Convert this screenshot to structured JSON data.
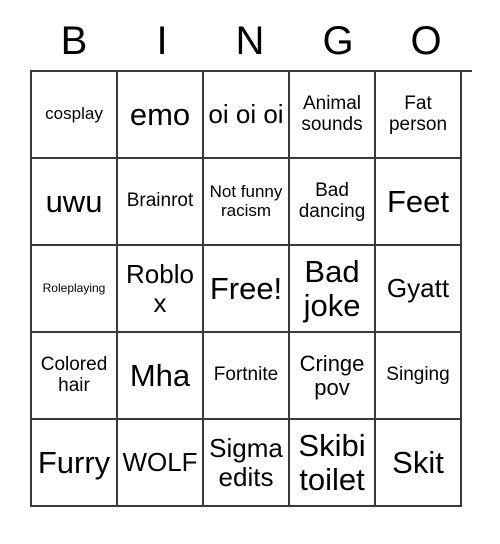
{
  "card": {
    "header_letters": [
      "B",
      "I",
      "N",
      "G",
      "O"
    ],
    "columns": 5,
    "rows": 5,
    "free_space_label": "Free!",
    "border_color": "#3a3a3a",
    "background_color": "#ffffff",
    "text_color": "#000000",
    "cells": [
      [
        {
          "label": "cosplay",
          "size": "sm"
        },
        {
          "label": "emo",
          "size": "xxl"
        },
        {
          "label": "oi oi oi",
          "size": "xl"
        },
        {
          "label": "Animal sounds",
          "size": "md"
        },
        {
          "label": "Fat person",
          "size": "md"
        }
      ],
      [
        {
          "label": "uwu",
          "size": "xxl"
        },
        {
          "label": "Brainrot",
          "size": "md"
        },
        {
          "label": "Not funny racism",
          "size": "sm"
        },
        {
          "label": "Bad dancing",
          "size": "md"
        },
        {
          "label": "Feet",
          "size": "xxl"
        }
      ],
      [
        {
          "label": "Roleplaying",
          "size": "xs"
        },
        {
          "label": "Roblox",
          "size": "xl"
        },
        {
          "label": "Free!",
          "size": "xxl"
        },
        {
          "label": "Bad joke",
          "size": "xxl"
        },
        {
          "label": "Gyatt",
          "size": "xl"
        }
      ],
      [
        {
          "label": "Colored hair",
          "size": "md"
        },
        {
          "label": "Mha",
          "size": "xxl"
        },
        {
          "label": "Fortnite",
          "size": "md"
        },
        {
          "label": "Cringe pov",
          "size": "lg"
        },
        {
          "label": "Singing",
          "size": "md"
        }
      ],
      [
        {
          "label": "Furry",
          "size": "xxl"
        },
        {
          "label": "WOLF",
          "size": "xl"
        },
        {
          "label": "Sigma edits",
          "size": "xl"
        },
        {
          "label": "Skibi toilet",
          "size": "xxl"
        },
        {
          "label": "Skit",
          "size": "xxl"
        }
      ]
    ]
  }
}
